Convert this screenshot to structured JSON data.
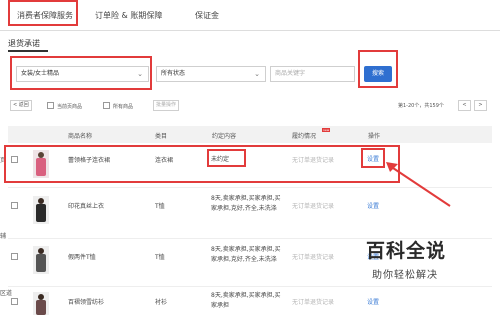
{
  "tabs": [
    {
      "label": "消费者保障服务"
    },
    {
      "label": "订单险 & 账期保障"
    },
    {
      "label": "保证金"
    }
  ],
  "section_title": "退货承诺",
  "filters": {
    "category": "女装/女士精品",
    "status": "所有状态",
    "keyword_placeholder": "商品关键字",
    "search_label": "搜索"
  },
  "toolbar": {
    "back_label": "< 返回",
    "current_page_label": "当前页商品",
    "all_label": "所有商品",
    "batch_label": "批量操作",
    "pagination": "第1-20个，共159个"
  },
  "table": {
    "headers": [
      "商品名称",
      "类目",
      "约定内容",
      "履约情况",
      "操作"
    ],
    "header_badge": "new",
    "rows": [
      {
        "name": "蕾领格子连衣裙",
        "category": "连衣裙",
        "promise": "未约定",
        "status": "无订单退货记录",
        "action": "设置"
      },
      {
        "name": "印花真丝上衣",
        "category": "T恤",
        "promise": "8天,卖家承担,买家承担,买家承担,克好,齐全,未洗涤",
        "status": "无订单退货记录",
        "action": "设置"
      },
      {
        "name": "假两件T恤",
        "category": "T恤",
        "promise": "8天,卖家承担,买家承担,买家承担,克好,齐全,未洗涤",
        "status": "无订单退货记录",
        "action": "设置"
      },
      {
        "name": "百褶领雪纺衫",
        "category": "衬衫",
        "promise": "8天,卖家承担,买家承担,买家承担",
        "status": "无订单退货记录",
        "action": "设置"
      }
    ]
  },
  "left_edge": [
    "页",
    "辅",
    "区道"
  ],
  "watermark": {
    "title": "百科全说",
    "subtitle": "助你轻松解决"
  },
  "colors": {
    "highlight": "#e23b3b",
    "link": "#3a7bd5",
    "search_bg": "#2f6fd0"
  }
}
